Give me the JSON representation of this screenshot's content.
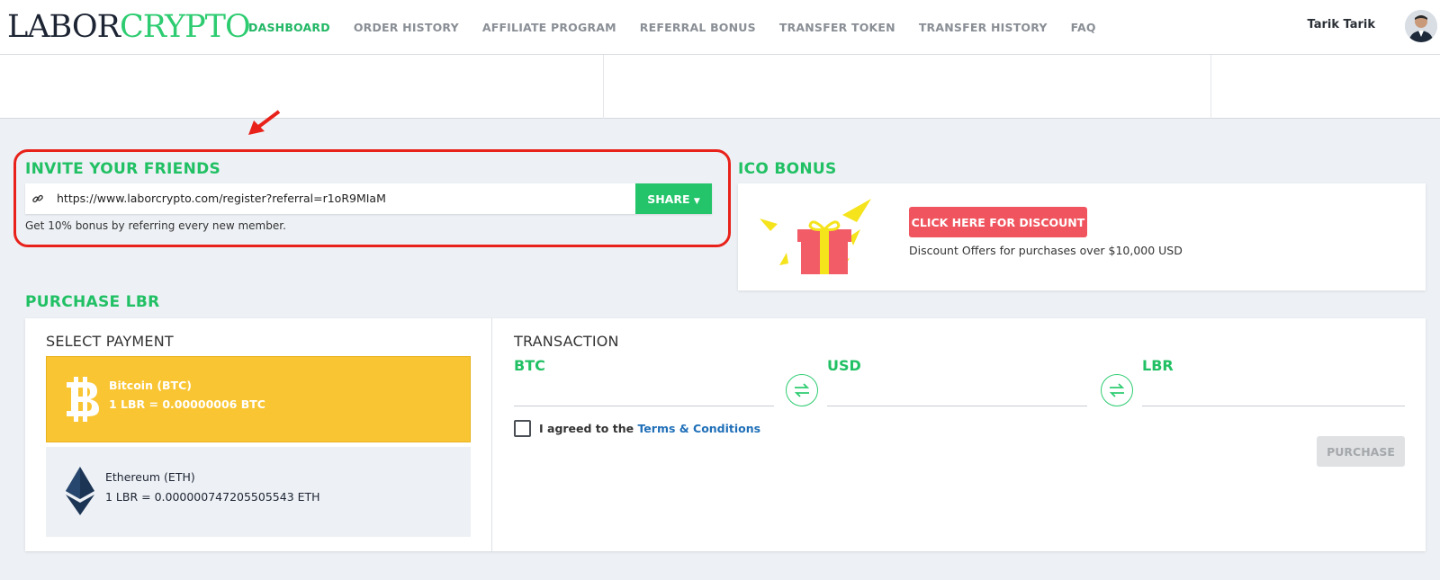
{
  "header": {
    "logo_part1": "LABOR",
    "logo_part2": "CRYPTO",
    "nav": [
      {
        "label": "DASHBOARD"
      },
      {
        "label": "ORDER HISTORY"
      },
      {
        "label": "AFFILIATE PROGRAM"
      },
      {
        "label": "REFERRAL BONUS"
      },
      {
        "label": "TRANSFER TOKEN"
      },
      {
        "label": "TRANSFER HISTORY"
      },
      {
        "label": "FAQ"
      }
    ],
    "active_nav": "DASHBOARD",
    "user_name": "Tarik Tarik"
  },
  "invite": {
    "title": "INVITE YOUR FRIENDS",
    "url": "https://www.laborcrypto.com/register?referral=r1oR9MIaM",
    "share_label": "SHARE",
    "note": "Get 10% bonus by referring every new member."
  },
  "ico": {
    "title": "ICO BONUS",
    "button_label": "CLICK HERE FOR DISCOUNT",
    "note": "Discount Offers for purchases over $10,000 USD"
  },
  "purchase": {
    "title": "PURCHASE LBR",
    "select_payment_title": "SELECT PAYMENT",
    "options": [
      {
        "name": "Bitcoin (BTC)",
        "rate": "1 LBR = 0.00000006 BTC"
      },
      {
        "name": "Ethereum (ETH)",
        "rate": "1 LBR = 0.000000747205505543 ETH"
      }
    ],
    "transaction_title": "TRANSACTION",
    "currencies": [
      "BTC",
      "USD",
      "LBR"
    ],
    "agree_text": "I agreed to the",
    "terms_link": "Terms & Conditions",
    "purchase_label": "PURCHASE"
  },
  "colors": {
    "brand_green": "#21c064",
    "logo_dark": "#1d2433",
    "btc_yellow": "#f9c533",
    "discount_red": "#f0555f",
    "highlight_red": "#e8221a"
  },
  "icons": [
    "link-icon",
    "dropdown-caret-icon",
    "gift-icon",
    "bitcoin-icon",
    "ethereum-icon",
    "swap-icon",
    "red-arrow-annotation"
  ]
}
